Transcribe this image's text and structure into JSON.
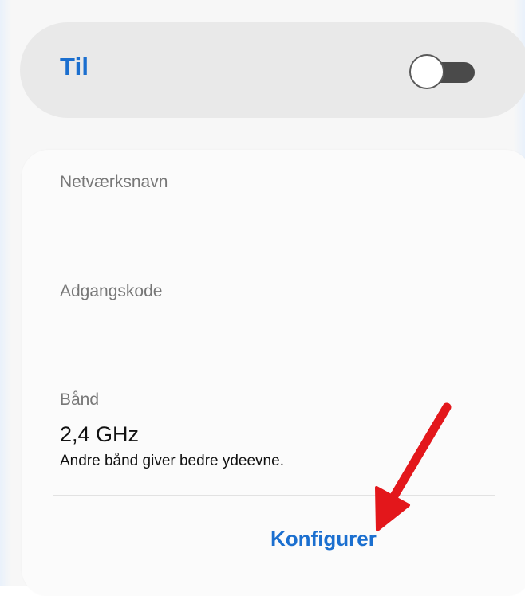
{
  "toggle": {
    "label": "Til",
    "state": "off"
  },
  "fields": {
    "network_name_label": "Netværksnavn",
    "password_label": "Adgangskode",
    "band_label": "Bånd",
    "band_value": "2,4 GHz",
    "band_description": "Andre bånd giver bedre ydeevne."
  },
  "actions": {
    "configure_label": "Konfigurer"
  },
  "colors": {
    "accent": "#1b6fcf",
    "annotation_arrow": "#e3171b"
  },
  "icons": {
    "switch": "toggle-switch-icon",
    "annotation": "red-arrow-annotation"
  }
}
